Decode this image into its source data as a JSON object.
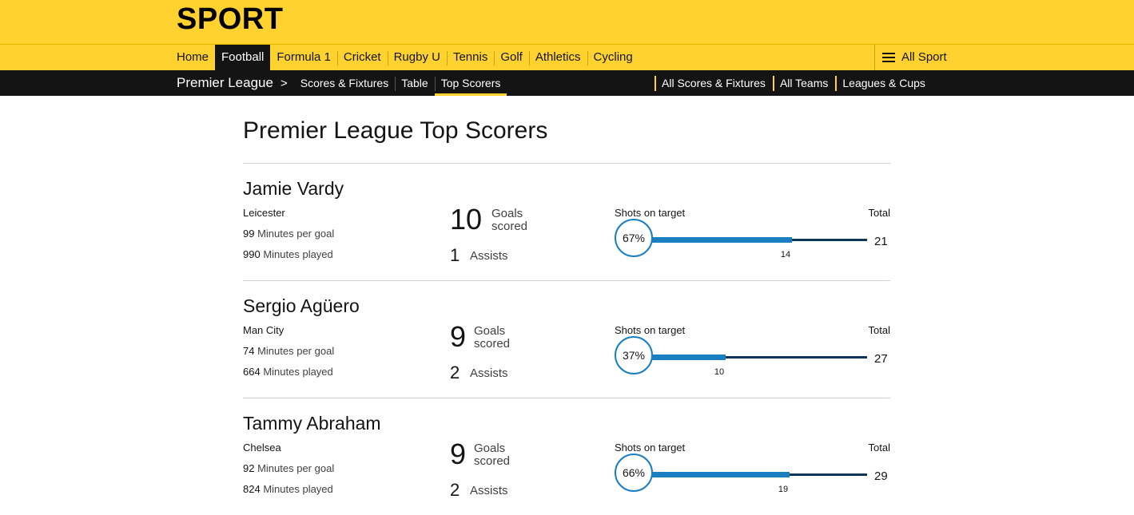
{
  "brand": "SPORT",
  "nav": {
    "items": [
      "Home",
      "Football",
      "Formula 1",
      "Cricket",
      "Rugby U",
      "Tennis",
      "Golf",
      "Athletics",
      "Cycling"
    ],
    "active": "Football",
    "all_sport": "All Sport"
  },
  "subnav": {
    "section": "Premier League",
    "items": [
      "Scores & Fixtures",
      "Table",
      "Top Scorers"
    ],
    "active": "Top Scorers",
    "right_items": [
      "All Scores & Fixtures",
      "All Teams",
      "Leagues & Cups"
    ]
  },
  "page_title": "Premier League Top Scorers",
  "labels": {
    "minutes_per_goal": "Minutes per goal",
    "minutes_played": "Minutes played",
    "goals_line1": "Goals",
    "goals_line2": "scored",
    "assists": "Assists",
    "shots_on_target": "Shots on target",
    "total": "Total"
  },
  "players": [
    {
      "name": "Jamie Vardy",
      "team": "Leicester",
      "minutes_per_goal": "99",
      "minutes_played": "990",
      "goals": "10",
      "assists": "1",
      "shots_on_target_pct": "67%",
      "shots_on_target": "14",
      "shots_total": "21",
      "sot_fraction": 0.667
    },
    {
      "name": "Sergio Agüero",
      "team": "Man City",
      "minutes_per_goal": "74",
      "minutes_played": "664",
      "goals": "9",
      "assists": "2",
      "shots_on_target_pct": "37%",
      "shots_on_target": "10",
      "shots_total": "27",
      "sot_fraction": 0.37
    },
    {
      "name": "Tammy Abraham",
      "team": "Chelsea",
      "minutes_per_goal": "92",
      "minutes_played": "824",
      "goals": "9",
      "assists": "2",
      "shots_on_target_pct": "66%",
      "shots_on_target": "19",
      "shots_total": "29",
      "sot_fraction": 0.655
    }
  ],
  "colors": {
    "brand_yellow": "#ffd230",
    "nav_dark": "#141414",
    "bar_fill": "#1a7fc1",
    "bar_track": "#0d3459"
  }
}
